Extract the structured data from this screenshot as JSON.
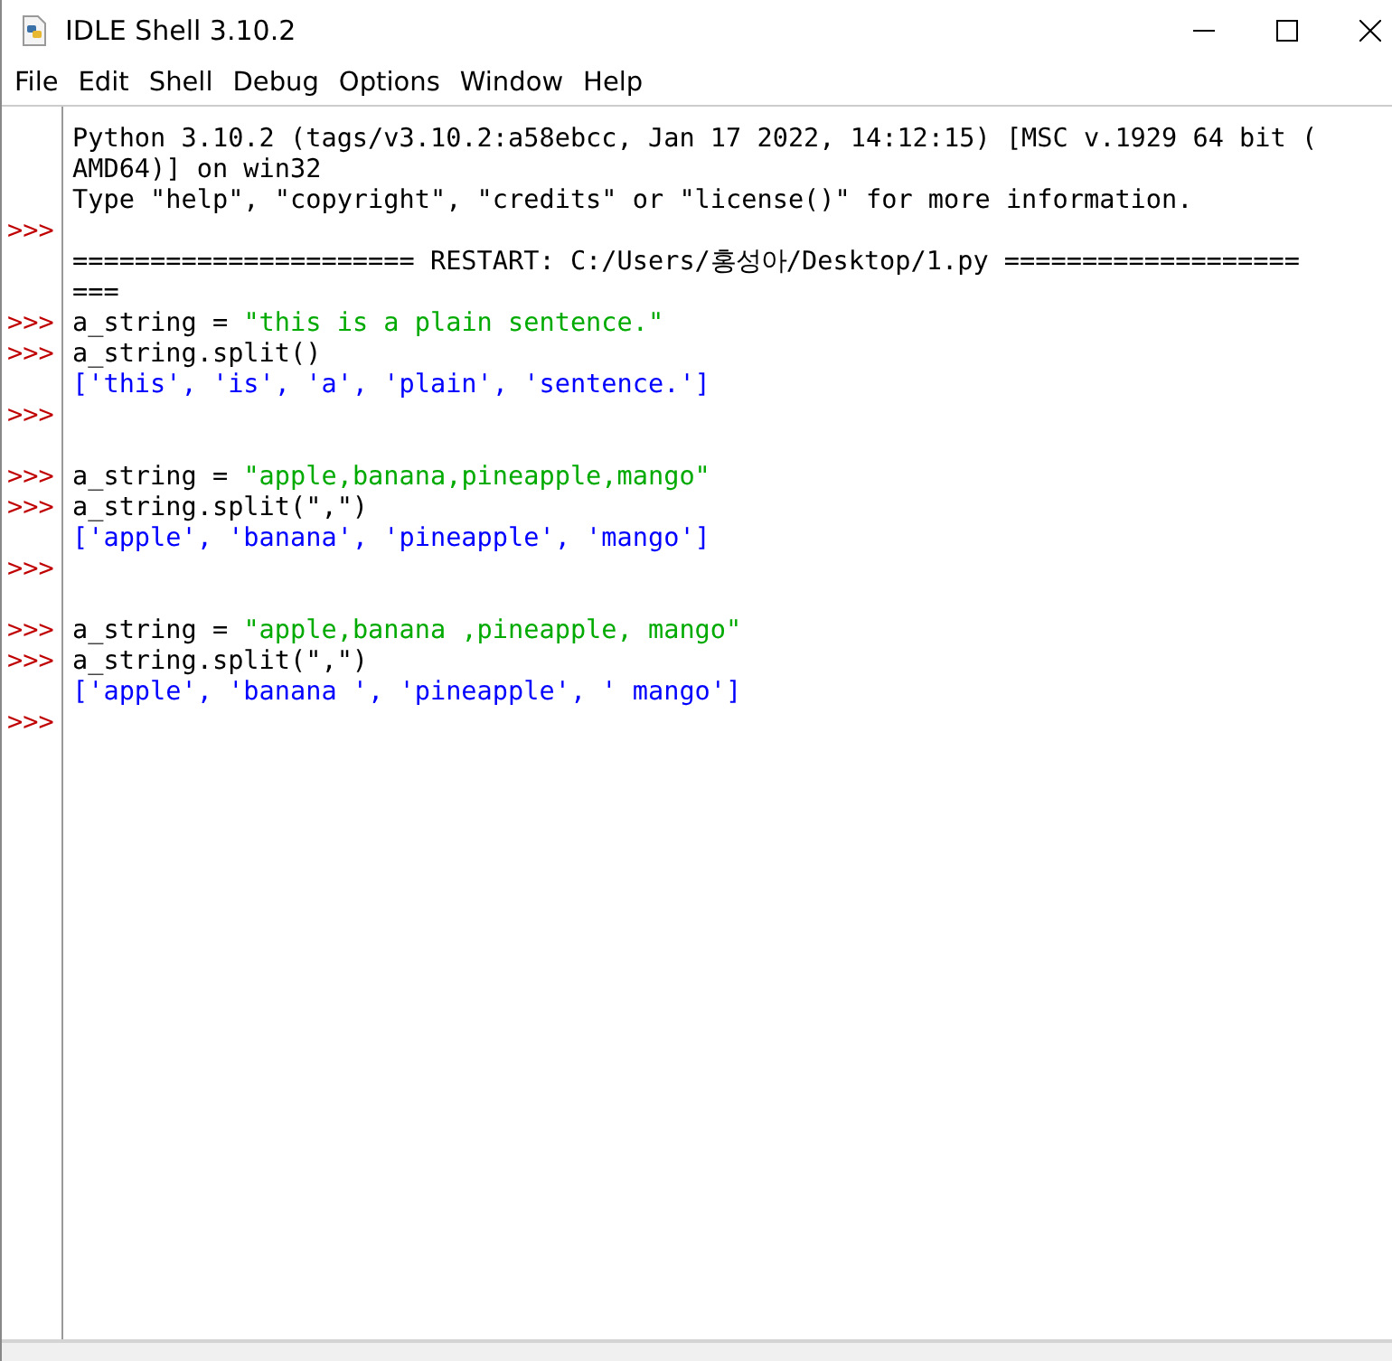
{
  "window": {
    "title": "IDLE Shell 3.10.2"
  },
  "menu": [
    "File",
    "Edit",
    "Shell",
    "Debug",
    "Options",
    "Window",
    "Help"
  ],
  "shell": {
    "prompt": ">>>",
    "lines": [
      {
        "prompt": false,
        "segments": [
          {
            "kind": "plain",
            "text": "Python 3.10.2 (tags/v3.10.2:a58ebcc, Jan 17 2022, 14:12:15) [MSC v.1929 64 bit ("
          }
        ]
      },
      {
        "prompt": false,
        "segments": [
          {
            "kind": "plain",
            "text": "AMD64)] on win32"
          }
        ]
      },
      {
        "prompt": false,
        "segments": [
          {
            "kind": "plain",
            "text": "Type \"help\", \"copyright\", \"credits\" or \"license()\" for more information."
          }
        ]
      },
      {
        "prompt": true
      },
      {
        "prompt": false,
        "segments": [
          {
            "kind": "plain",
            "text": "====================== RESTART: C:/Users/홍성아/Desktop/1.py ==================="
          }
        ]
      },
      {
        "prompt": false,
        "segments": [
          {
            "kind": "plain",
            "text": "==="
          }
        ]
      },
      {
        "prompt": true,
        "segments": [
          {
            "kind": "plain",
            "text": "a_string = "
          },
          {
            "kind": "string",
            "text": "\"this is a plain sentence.\""
          }
        ]
      },
      {
        "prompt": true,
        "segments": [
          {
            "kind": "plain",
            "text": "a_string.split()"
          }
        ]
      },
      {
        "prompt": false,
        "segments": [
          {
            "kind": "output",
            "text": "['this', 'is', 'a', 'plain', 'sentence.']"
          }
        ]
      },
      {
        "prompt": true
      },
      {
        "prompt": false
      },
      {
        "prompt": true,
        "segments": [
          {
            "kind": "plain",
            "text": "a_string = "
          },
          {
            "kind": "string",
            "text": "\"apple,banana,pineapple,mango\""
          }
        ]
      },
      {
        "prompt": true,
        "segments": [
          {
            "kind": "plain",
            "text": "a_string.split(\",\")"
          }
        ]
      },
      {
        "prompt": false,
        "segments": [
          {
            "kind": "output",
            "text": "['apple', 'banana', 'pineapple', 'mango']"
          }
        ]
      },
      {
        "prompt": true
      },
      {
        "prompt": false
      },
      {
        "prompt": true,
        "segments": [
          {
            "kind": "plain",
            "text": "a_string = "
          },
          {
            "kind": "string",
            "text": "\"apple,banana ,pineapple, mango\""
          }
        ]
      },
      {
        "prompt": true,
        "segments": [
          {
            "kind": "plain",
            "text": "a_string.split(\",\")"
          }
        ]
      },
      {
        "prompt": false,
        "segments": [
          {
            "kind": "output",
            "text": "['apple', 'banana ', 'pineapple', ' mango']"
          }
        ]
      },
      {
        "prompt": true
      }
    ]
  }
}
